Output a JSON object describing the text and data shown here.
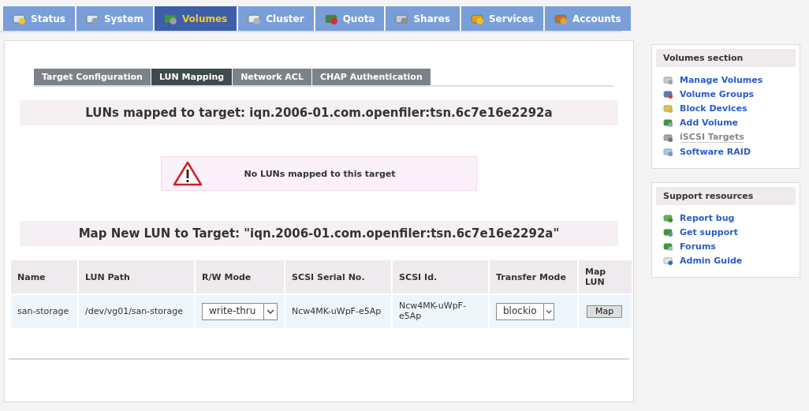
{
  "nav_tabs": [
    {
      "label": "Status",
      "selected": false
    },
    {
      "label": "System",
      "selected": false
    },
    {
      "label": "Volumes",
      "selected": true
    },
    {
      "label": "Cluster",
      "selected": false
    },
    {
      "label": "Quota",
      "selected": false
    },
    {
      "label": "Shares",
      "selected": false
    },
    {
      "label": "Services",
      "selected": false
    },
    {
      "label": "Accounts",
      "selected": false
    }
  ],
  "sub_tabs": [
    {
      "label": "Target Configuration",
      "selected": false
    },
    {
      "label": "LUN Mapping",
      "selected": true
    },
    {
      "label": "Network ACL",
      "selected": false
    },
    {
      "label": "CHAP Authentication",
      "selected": false
    }
  ],
  "mapped_heading": "LUNs mapped to target: iqn.2006-01.com.openfiler:tsn.6c7e16e2292a",
  "warning": "No LUNs mapped to this target",
  "map_heading": "Map New LUN to Target: \"iqn.2006-01.com.openfiler:tsn.6c7e16e2292a\"",
  "table": {
    "columns": [
      "Name",
      "LUN Path",
      "R/W Mode",
      "SCSI Serial No.",
      "SCSI Id.",
      "Transfer Mode",
      "Map LUN"
    ],
    "rows": [
      {
        "name": "san-storage",
        "lun_path": "/dev/vg01/san-storage",
        "rw_mode": "write-thru",
        "serial": "Ncw4MK-uWpF-e5Ap",
        "scsi_id": "Ncw4MK-uWpF-e5Ap",
        "transfer_mode": "blockio",
        "button": "Map"
      }
    ]
  },
  "sidebar": [
    {
      "title": "Volumes section",
      "items": [
        {
          "label": "Manage Volumes",
          "selected": false
        },
        {
          "label": "Volume Groups",
          "selected": false
        },
        {
          "label": "Block Devices",
          "selected": false
        },
        {
          "label": "Add Volume",
          "selected": false
        },
        {
          "label": "iSCSI Targets",
          "selected": true
        },
        {
          "label": "Software RAID",
          "selected": false
        }
      ]
    },
    {
      "title": "Support resources",
      "items": [
        {
          "label": "Report bug",
          "selected": false
        },
        {
          "label": "Get support",
          "selected": false
        },
        {
          "label": "Forums",
          "selected": false
        },
        {
          "label": "Admin Guide",
          "selected": false
        }
      ]
    }
  ]
}
